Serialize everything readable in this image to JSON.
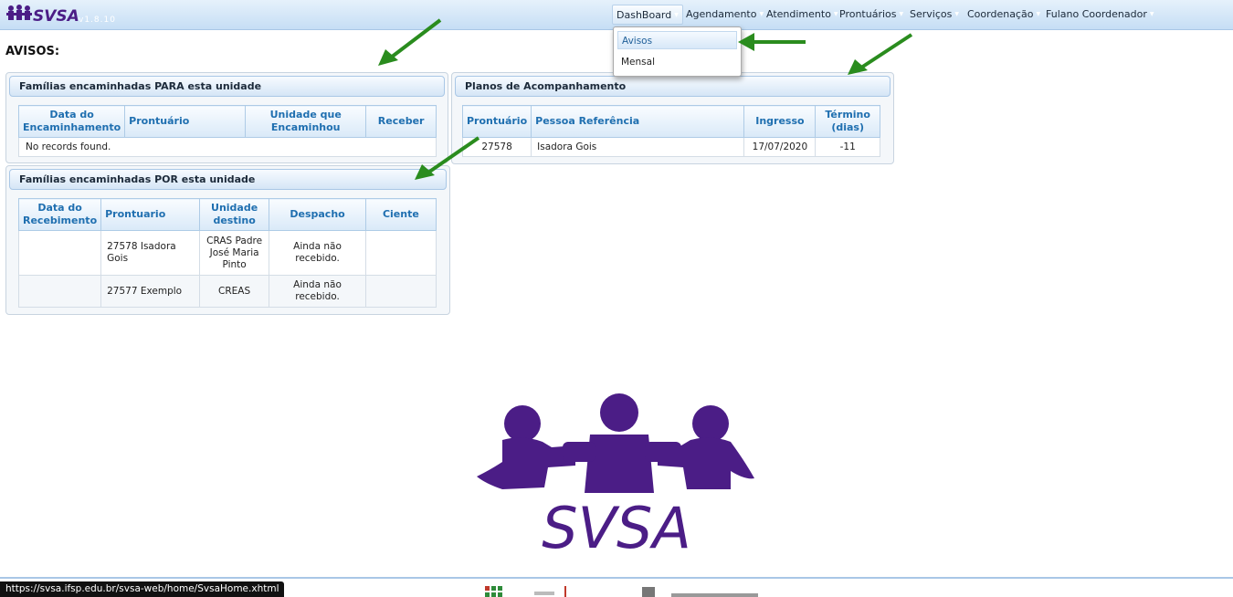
{
  "app": {
    "logo_text": "SVSA",
    "version": "v1.8.10"
  },
  "menu": {
    "items": [
      {
        "label": "DashBoard",
        "has_caret": true
      },
      {
        "label": "Agendamento",
        "has_caret": true
      },
      {
        "label": "Atendimento",
        "has_caret": true
      },
      {
        "label": "Prontuários",
        "has_caret": true
      },
      {
        "label": "Serviços",
        "has_caret": true
      },
      {
        "label": "Coordenação",
        "has_caret": true
      },
      {
        "label": "Fulano Coordenador",
        "has_caret": true
      }
    ],
    "dropdown": {
      "items": [
        "Avisos",
        "Mensal"
      ]
    }
  },
  "page": {
    "title": "AVISOS:"
  },
  "panel_para": {
    "title": "Famílias encaminhadas PARA esta unidade",
    "columns": [
      "Data do Encaminhamento",
      "Prontuário",
      "Unidade que Encaminhou",
      "Receber"
    ],
    "empty_message": "No records found."
  },
  "panel_por": {
    "title": "Famílias encaminhadas POR esta unidade",
    "columns": [
      "Data do Recebimento",
      "Prontuario",
      "Unidade destino",
      "Despacho",
      "Ciente"
    ],
    "rows": [
      {
        "data": "",
        "prontuario": "27578 Isadora Gois",
        "unidade": "CRAS Padre José Maria Pinto",
        "despacho": "Ainda não recebido.",
        "ciente": ""
      },
      {
        "data": "",
        "prontuario": "27577 Exemplo",
        "unidade": "CREAS",
        "despacho": "Ainda não recebido.",
        "ciente": ""
      }
    ]
  },
  "panel_planos": {
    "title": "Planos de Acompanhamento",
    "columns": [
      "Prontuário",
      "Pessoa Referência",
      "Ingresso",
      "Término (dias)"
    ],
    "rows": [
      {
        "prontuario": "27578",
        "pessoa": "Isadora Gois",
        "ingresso": "17/07/2020",
        "termino": "-11"
      }
    ]
  },
  "big_logo": {
    "text": "SVSA"
  },
  "status_bar": {
    "url": "https://svsa.ifsp.edu.br/svsa-web/home/SvsaHome.xhtml"
  },
  "colors": {
    "brand_purple": "#4b1d86",
    "header_blue": "#c6def5",
    "arrow_green": "#2a8c1e",
    "th_text": "#1f6fb0"
  }
}
